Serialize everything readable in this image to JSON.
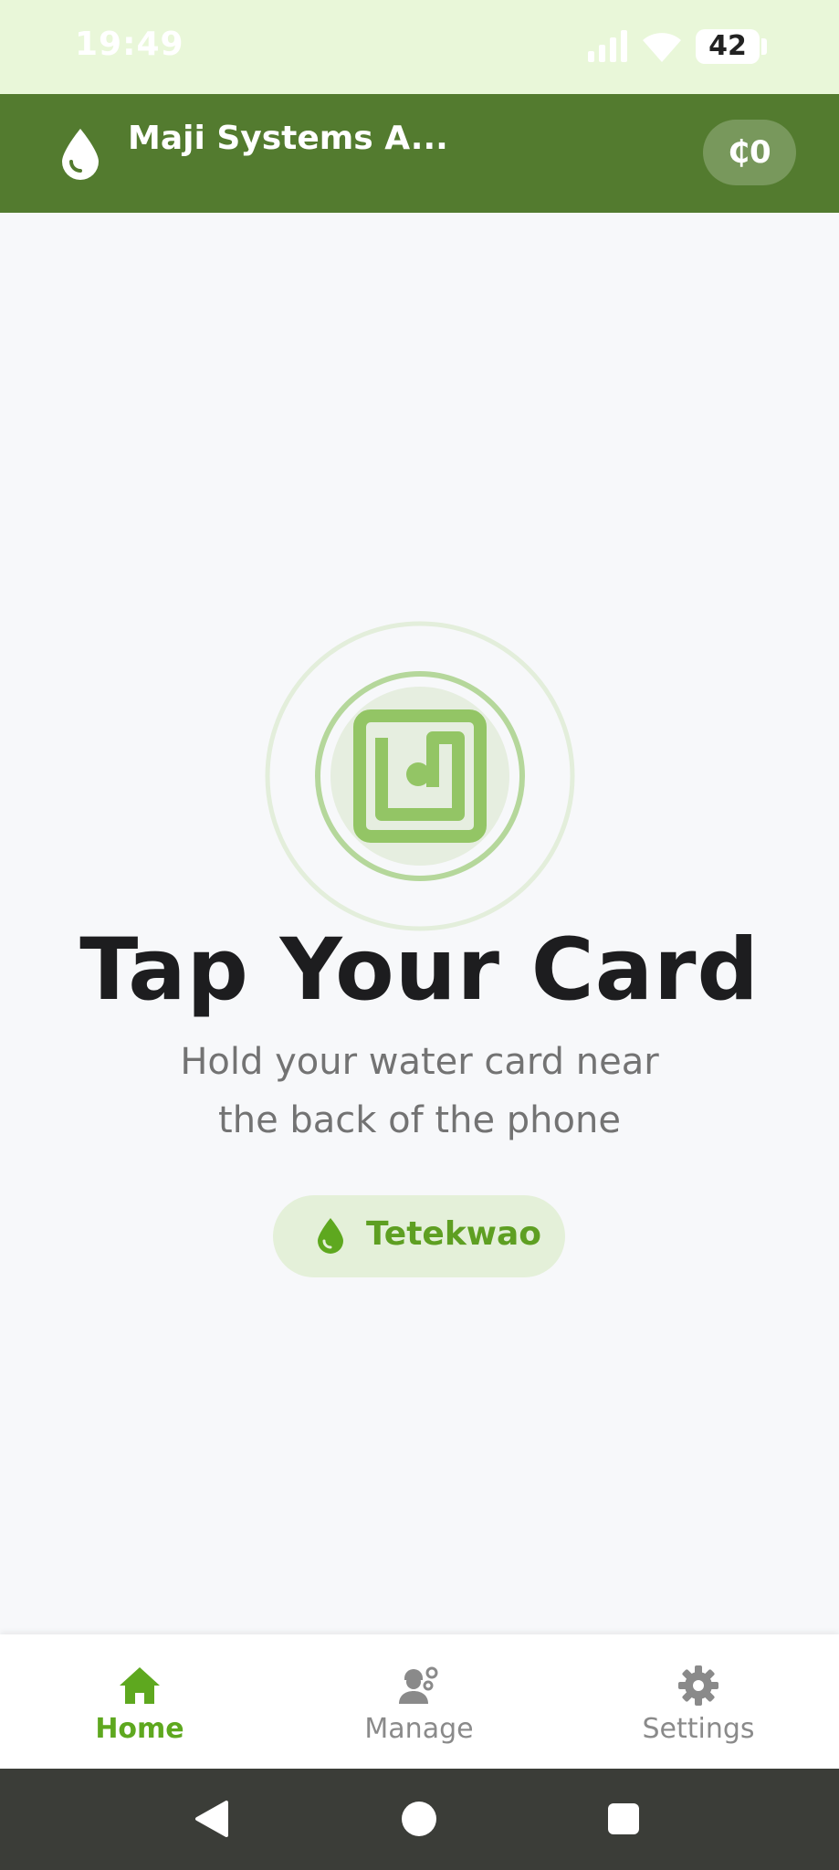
{
  "status_bar": {
    "time": "19:49",
    "battery_level": "42",
    "icons": [
      "signal-icon",
      "wifi-icon",
      "battery-icon"
    ]
  },
  "app_bar": {
    "title": "Maji Systems A...",
    "logo_icon": "water-drop-icon",
    "balance": "₵0"
  },
  "main": {
    "nfc_icon": "nfc-icon",
    "title": "Tap Your Card",
    "subtitle_line1": "Hold your water card near",
    "subtitle_line2": "the back of the phone",
    "station": {
      "icon": "water-drop-icon",
      "name": "Tetekwao"
    }
  },
  "bottom_nav": {
    "items": [
      {
        "label": "Home",
        "icon": "home-icon",
        "active": true
      },
      {
        "label": "Manage",
        "icon": "manage-workers-icon",
        "active": false
      },
      {
        "label": "Settings",
        "icon": "gear-icon",
        "active": false
      }
    ]
  },
  "system_nav": {
    "icons": [
      "back-icon",
      "home-circle-icon",
      "recents-icon"
    ]
  },
  "colors": {
    "status_bar_bg": "#e9f7d9",
    "app_bar_bg": "#537b2f",
    "accent_green": "#5ea81f",
    "nfc_green": "#93c565",
    "chip_bg": "#e4f0d9",
    "page_bg": "#f7f8fa",
    "system_nav_bg": "#3b3d38"
  }
}
